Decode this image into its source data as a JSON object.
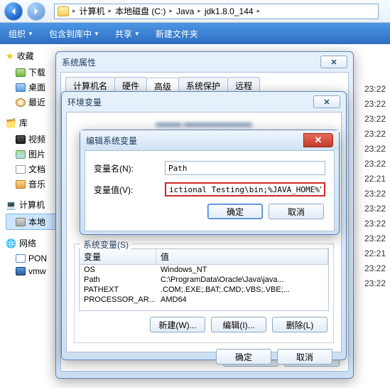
{
  "breadcrumb": {
    "p1": "计算机",
    "p2": "本地磁盘 (C:)",
    "p3": "Java",
    "p4": "jdk1.8.0_144"
  },
  "toolbar": {
    "organize": "组织",
    "include": "包含到库中",
    "share": "共享",
    "newfolder": "新建文件夹"
  },
  "sidebar": {
    "fav": "收藏",
    "dl": "下载",
    "desk": "桌面",
    "recent": "最近",
    "lib": "库",
    "video": "视频",
    "pic": "图片",
    "doc": "文档",
    "music": "音乐",
    "computer": "计算机",
    "local": "本地",
    "network": "网络",
    "pom": "PON",
    "vmw": "vmw"
  },
  "times": [
    "23:22",
    "23:22",
    "23:22",
    "23:22",
    "23:22",
    "23:22",
    "22:21",
    "23:22",
    "23:22",
    "23:22",
    "23:22",
    "22:21",
    "23:22",
    "23:22"
  ],
  "sysprops": {
    "title": "系统属性",
    "tabs": {
      "computer": "计算机名",
      "hardware": "硬件",
      "advanced": "高级",
      "protect": "系统保护",
      "remote": "远程"
    },
    "envvar_title": "环境变量",
    "sysvar_label": "系统变量(S)",
    "col_var": "变量",
    "col_val": "值",
    "rows": [
      {
        "v": "OS",
        "d": "Windows_NT"
      },
      {
        "v": "Path",
        "d": "C:\\ProgramData\\Oracle\\Java\\java..."
      },
      {
        "v": "PATHEXT",
        "d": ".COM;.EXE;.BAT;.CMD;.VBS;.VBE;..."
      },
      {
        "v": "PROCESSOR_AR...",
        "d": "AMD64"
      }
    ],
    "new": "新建(W)...",
    "edit": "编辑(I)...",
    "del": "删除(L)",
    "ok": "确定",
    "cancel": "取消"
  },
  "editdlg": {
    "title": "编辑系统变量",
    "name_lbl": "变量名(N):",
    "name_val": "Path",
    "val_lbl": "变量值(V):",
    "val_val": "ictional Testing\\bin;%JAVA_HOME%\\bin",
    "ok": "确定",
    "cancel": "取消"
  }
}
